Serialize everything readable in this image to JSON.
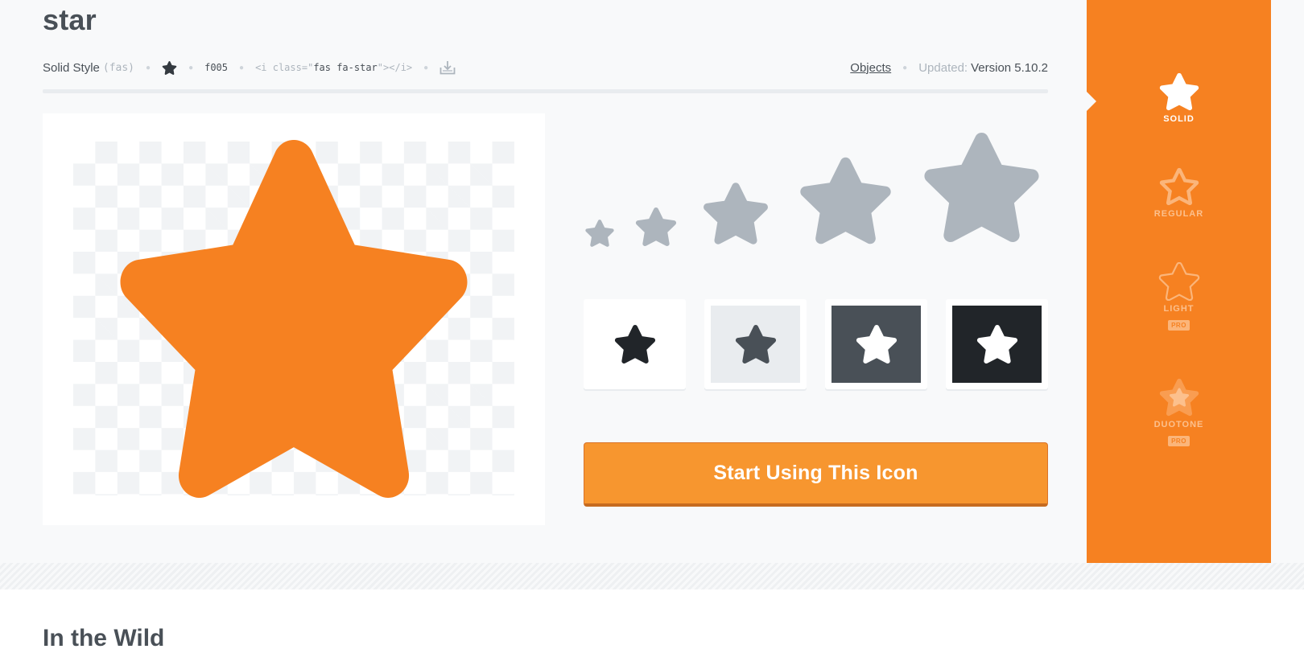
{
  "page": {
    "title": "star"
  },
  "meta": {
    "style_label": "Solid Style",
    "style_prefix": "(fas)",
    "unicode": "f005",
    "code_open": "<i class=\"",
    "code_class": "fas fa-star",
    "code_close": "\"></i>",
    "category_link": "Objects",
    "updated_label": "Updated:",
    "version": "Version 5.10.2"
  },
  "icons": {
    "star": "star-icon",
    "download": "download-icon"
  },
  "colors": {
    "accent_orange": "#f68121",
    "button_orange": "#f7962f",
    "star_gray": "#adb5bd",
    "dark": "#212529",
    "dark_gray": "#495057",
    "light_gray": "#e9ecef"
  },
  "swatches": [
    {
      "name": "white-background",
      "bg": "#ffffff",
      "star": "#212529"
    },
    {
      "name": "light-background",
      "bg": "#e9ecef",
      "star": "#495057"
    },
    {
      "name": "gray-background",
      "bg": "#495057",
      "star": "#ffffff"
    },
    {
      "name": "dark-background",
      "bg": "#212529",
      "star": "#ffffff"
    }
  ],
  "cta": {
    "label": "Start Using This Icon"
  },
  "style_options": [
    {
      "label": "SOLID",
      "active": true,
      "pro": false
    },
    {
      "label": "REGULAR",
      "active": false,
      "pro": false
    },
    {
      "label": "LIGHT",
      "active": false,
      "pro": true,
      "pro_label": "PRO"
    },
    {
      "label": "DUOTONE",
      "active": false,
      "pro": true,
      "pro_label": "PRO"
    }
  ],
  "section": {
    "title": "In the Wild"
  }
}
